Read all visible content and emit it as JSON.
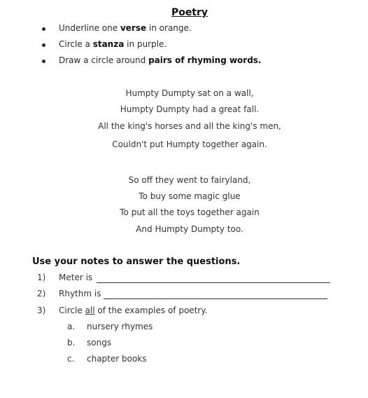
{
  "title": "Poetry",
  "instructions": [
    {
      "before": "Underline one ",
      "bold": "verse",
      "after": " in orange."
    },
    {
      "before": "Circle a ",
      "bold": "stanza",
      "after": " in purple."
    },
    {
      "before": "Draw a circle around ",
      "bold": "pairs of rhyming words.",
      "after": ""
    }
  ],
  "poem": {
    "stanza1": [
      "Humpty Dumpty sat on a wall,",
      "Humpty Dumpty had a great fall.",
      "All the king's horses and all the king's men,",
      "Couldn't put Humpty together again."
    ],
    "stanza2": [
      "So off they went to fairyland,",
      "To buy some magic glue",
      "To put all the toys together again",
      "And Humpty Dumpty too."
    ]
  },
  "questions_heading": "Use your notes to answer the questions.",
  "questions": [
    {
      "num": "1)",
      "text": "Meter is"
    },
    {
      "num": "2)",
      "text": "Rhythm is"
    },
    {
      "num": "3)",
      "before": "Circle ",
      "underlined": "all",
      "after": " of the examples of poetry."
    }
  ],
  "options": [
    {
      "letter": "a.",
      "text": "nursery rhymes"
    },
    {
      "letter": "b.",
      "text": "songs"
    },
    {
      "letter": "c.",
      "text": "chapter books"
    }
  ]
}
